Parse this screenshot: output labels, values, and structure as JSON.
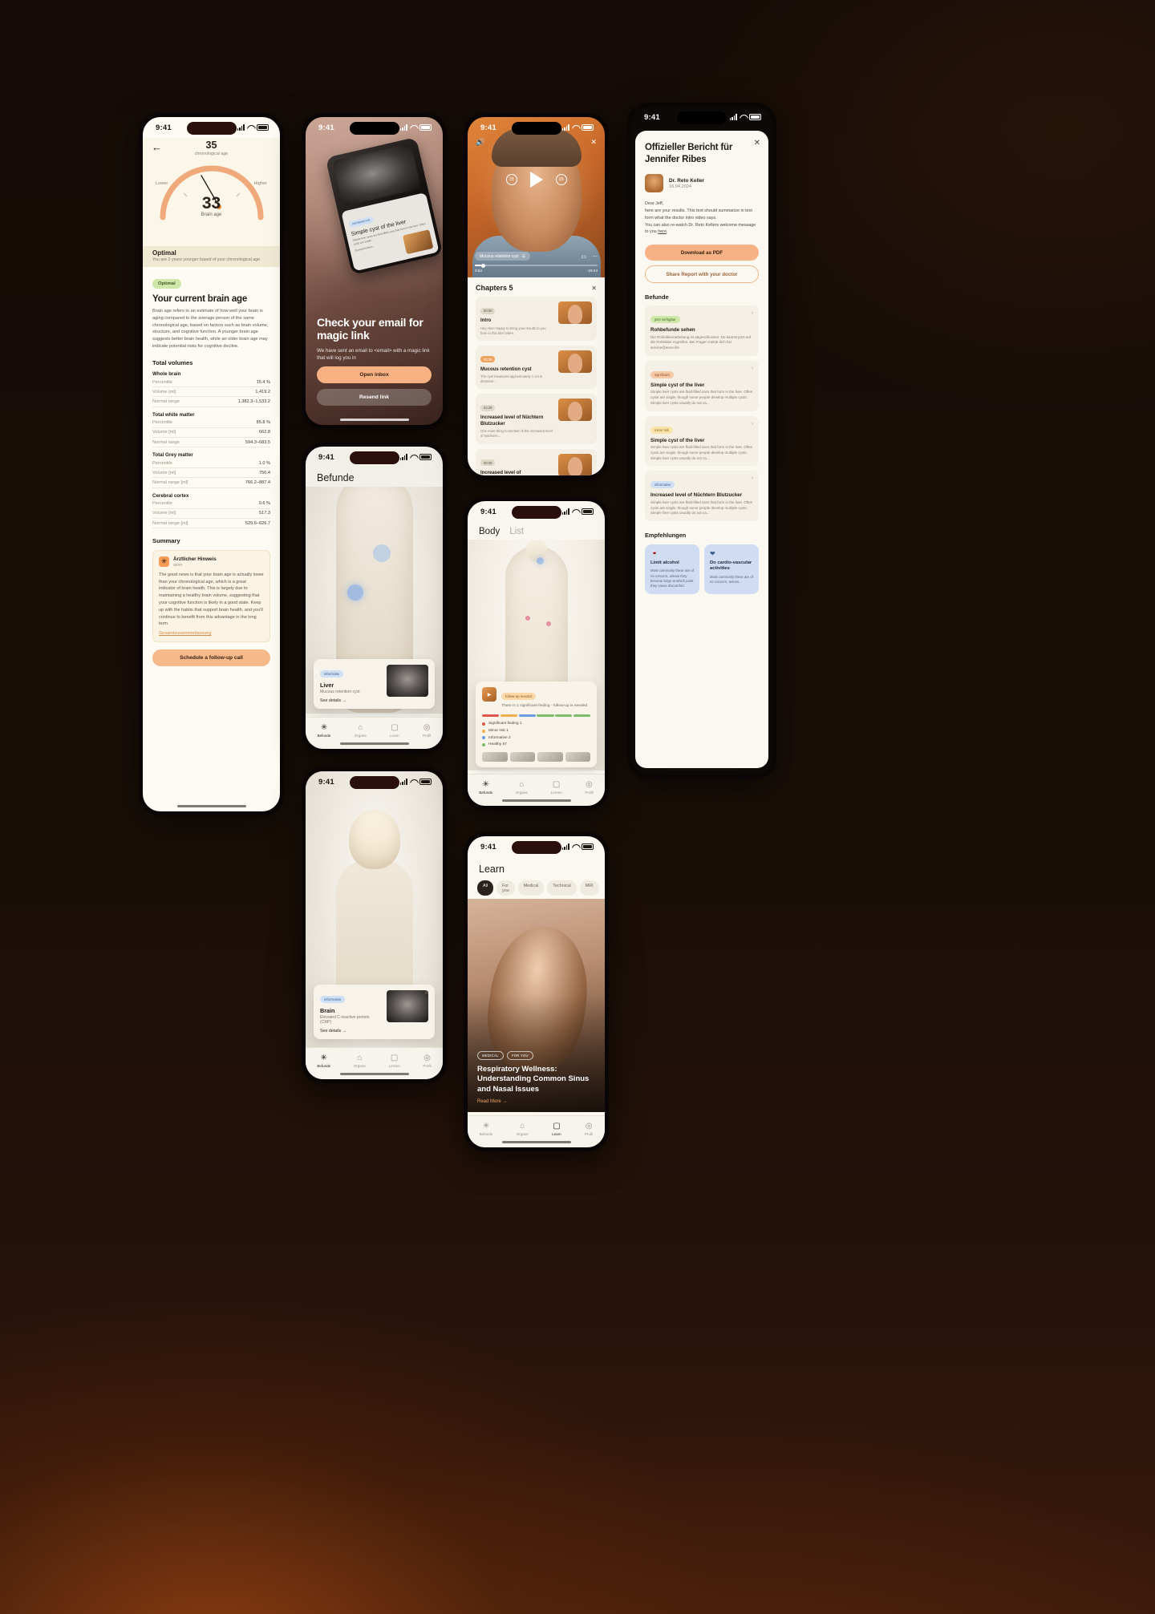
{
  "common": {
    "status_time": "9:41"
  },
  "brain_age": {
    "back_icon": "←",
    "chrono_value": "35",
    "chrono_label": "chronological age",
    "gauge_low": "Lower",
    "gauge_high": "Higher",
    "brain_age_value": "33",
    "brain_age_label": "Brain age",
    "banner_title": "Optimal",
    "banner_sub": "You are 2 years younger based of your chronological age",
    "badge": "Optimal",
    "title": "Your current brain age",
    "body": "Brain age refers to an estimate of how well your brain is aging compared to the average person of the same chronological age, based on factors such as brain volume, structure, and cognitive function. A younger brain age suggests better brain health, while an older brain age may indicate potential risks for cognitive decline.",
    "volumes_title": "Total volumes",
    "groups": [
      {
        "name": "Whole brain",
        "rows": [
          {
            "k": "Percentile",
            "v": "15.4 %"
          },
          {
            "k": "Volume [ml]",
            "v": "1,419.2"
          },
          {
            "k": "Normal range",
            "v": "1,382.3–1,533.2"
          }
        ]
      },
      {
        "name": "Total white matter",
        "rows": [
          {
            "k": "Percentile",
            "v": "85.8 %"
          },
          {
            "k": "Volume [ml]",
            "v": "662.8"
          },
          {
            "k": "Normal range",
            "v": "594.3–683.5"
          }
        ]
      },
      {
        "name": "Total Grey matter",
        "rows": [
          {
            "k": "Percentile",
            "v": "1.0 %"
          },
          {
            "k": "Volume [ml]",
            "v": "756.4"
          },
          {
            "k": "Normal range [ml]",
            "v": "766.2–887.4"
          }
        ]
      },
      {
        "name": "Cerebral cortex",
        "rows": [
          {
            "k": "Percentile",
            "v": "0.6 %"
          },
          {
            "k": "Volume [ml]",
            "v": "517.3"
          },
          {
            "k": "Normal range [ml]",
            "v": "529.6–626.7"
          }
        ]
      }
    ],
    "summary_title": "Summary",
    "note_icon": "✳",
    "note_name": "Ärztlicher Hinweis",
    "note_sub": "aeon",
    "note_body": "The good news is that your brain age is actually lower than your chronological age, which is a great indicator of brain health. This is largely due to maintaining a healthy brain volume, suggesting that your cognitive function is likely in a good state. Keep up with the habits that support brain health, and you'll continue to benefit from this advantage in the long term.",
    "note_link": "Gesamtzusammenfassung",
    "cta": "Schedule a follow-up call"
  },
  "magic_link": {
    "card_tag": "INFORMATIVE",
    "card_title": "Simple cyst of the liver",
    "card_text": "Simple liver cysts are fluid-filled sacs that form in the liver. Often cysts are single...",
    "card_link": "Zusammenfass...",
    "title": "Check your email for magic link",
    "body": "We have sent an email to <email> with a magic link that will log you in",
    "primary_btn": "Open inbox",
    "secondary_btn": "Resend link"
  },
  "befunde": {
    "title": "Befunde",
    "finding_tag": "informativ",
    "finding_title": "Liver",
    "finding_sub": "Mucous retention cyst",
    "finding_link": "See details  →",
    "tabs": [
      {
        "icon": "✳",
        "label": "Befunde",
        "active": true
      },
      {
        "icon": "⌂",
        "label": "Organe",
        "active": false
      },
      {
        "icon": "▢",
        "label": "Learn",
        "active": false
      },
      {
        "icon": "◎",
        "label": "Profil",
        "active": false
      }
    ]
  },
  "head_view": {
    "finding_tag": "informative",
    "finding_title": "Brain",
    "finding_sub": "Elevated C-reactive protein (CRP)",
    "finding_link": "See details  →",
    "close_icon": "✕",
    "tabs": [
      {
        "icon": "✳",
        "label": "Befunde",
        "active": true
      },
      {
        "icon": "⌂",
        "label": "Organe",
        "active": false
      },
      {
        "icon": "▢",
        "label": "Lernen",
        "active": false
      },
      {
        "icon": "◎",
        "label": "Profil",
        "active": false
      }
    ]
  },
  "video": {
    "mute_icon": "🔊",
    "close_icon": "✕",
    "skip_back": "15",
    "skip_fwd": "15",
    "chip_label": "Mucous retention cyst",
    "chip_icon": "☰",
    "airplay_icon": "▭",
    "more_icon": "⋯",
    "time_current": "0:54",
    "time_total": "-19:44",
    "chapters_title": "Chapters",
    "chapters_count": "5",
    "chapters_close": "✕",
    "chapters": [
      {
        "time": "00:00",
        "active": false,
        "title": "Intro",
        "text": "Hey Alex! Happy to bring your results to you here in this brief video."
      },
      {
        "time": "00:39",
        "active": true,
        "title": "Mucous retention cyst",
        "text": "The cyst measures approximately 1 cm in diameter..."
      },
      {
        "time": "02:29",
        "active": false,
        "title": "Increased level of Nüchtern Blutzucker",
        "text": "One more thing to mention is the increased level of Nüchtern..."
      },
      {
        "time": "00:29",
        "active": false,
        "title": "Increased level of",
        "text": ""
      }
    ]
  },
  "body_list": {
    "tabs": [
      {
        "label": "Body",
        "active": true
      },
      {
        "label": "List",
        "active": false
      }
    ],
    "card_tag": "follow-up needed",
    "card_text": "There is 1 significant finding - follow-up is needed.",
    "card_icon": "▶",
    "legend": [
      {
        "label": "Significant finding 1",
        "color": "#e0574f"
      },
      {
        "label": "Minor risk 1",
        "color": "#efb04a"
      },
      {
        "label": "Informative 2",
        "color": "#6b9ae0"
      },
      {
        "label": "Healthy 57",
        "color": "#7dbb6a"
      }
    ],
    "bar_colors": [
      "#e0574f",
      "#efb04a",
      "#6b9ae0",
      "#7dbb6a",
      "#7dbb6a",
      "#7dbb6a"
    ],
    "tabs_bottom": [
      {
        "icon": "✳",
        "label": "Befunde",
        "active": true
      },
      {
        "icon": "⌂",
        "label": "Organe",
        "active": false
      },
      {
        "icon": "▢",
        "label": "Lernen",
        "active": false
      },
      {
        "icon": "◎",
        "label": "Profil",
        "active": false
      }
    ]
  },
  "learn": {
    "title": "Learn",
    "chips": [
      {
        "label": "All",
        "active": true
      },
      {
        "label": "For you",
        "active": false
      },
      {
        "label": "Medical",
        "active": false
      },
      {
        "label": "Technical",
        "active": false
      },
      {
        "label": "MRI",
        "active": false
      }
    ],
    "hero_tags": [
      "MEDICAL",
      "FOR YOU"
    ],
    "hero_title": "Respiratory Wellness: Understanding Common Sinus and Nasal Issues",
    "hero_more": "Read More  →",
    "tabs": [
      {
        "icon": "✳",
        "label": "Befunde",
        "active": false
      },
      {
        "icon": "⌂",
        "label": "Organe",
        "active": false
      },
      {
        "icon": "▢",
        "label": "Learn",
        "active": true
      },
      {
        "icon": "◎",
        "label": "Profil",
        "active": false
      }
    ]
  },
  "report": {
    "close_icon": "✕",
    "title": "Offizieller Bericht für Jennifer Ribes",
    "doctor_name": "Dr. Reto Keller",
    "doctor_date": "16.04.2024",
    "intro_line1": "Dear Jeff,",
    "intro_line2": "here are your results. This text should summarize in text form what the doctor intro video says.",
    "intro_line3": "You can also re-watch Dr. Reto Kellers welcome message to you ",
    "intro_link": "here",
    "intro_end": ".",
    "btn_pdf": "Download as PDF",
    "btn_share": "Share Report with your doctor",
    "findings_title": "Befunde",
    "findings": [
      {
        "tag": "jetzt verfügbar",
        "tag_bg": "#cfe8a9",
        "tag_fg": "#42611f",
        "title": "Rohbefunde sehen",
        "text": "Die Rohbildverarbeitung ist abgeschlossen. Du kannst jetzt auf die Rohbilder zugreifen. Bei Fragen melde dich bei service@aeon.life"
      },
      {
        "tag": "significant",
        "tag_bg": "#f6c9a6",
        "tag_fg": "#8a4a1d",
        "title": "Simple cyst of the liver",
        "text": "Simple liver cysts are fluid-filled sacs that form in the liver. Often cysts are single, though some people develop multiple cysts. Simple liver cysts usually do not ca..."
      },
      {
        "tag": "minor risk",
        "tag_bg": "#fae3a8",
        "tag_fg": "#8a6a1d",
        "title": "Simple cyst of the liver",
        "text": "Simple liver cysts are fluid-filled sacs that form in the liver. Often cysts are single, though some people develop multiple cysts. Simple liver cysts usually do not ca..."
      },
      {
        "tag": "informative",
        "tag_bg": "#cfe0f5",
        "tag_fg": "#42608c",
        "title": "Increased level of Nüchtern Blutzucker",
        "text": "Simple liver cysts are fluid-filled sacs that form in the liver. Often cysts are single, though some people develop multiple cysts. Simple liver cysts usually do not ca..."
      }
    ],
    "rec_title": "Empfehlungen",
    "recommendations": [
      {
        "icon": "🍷",
        "title": "Limit alcohol",
        "text": "Most commonly these are of no concern, unless they become large at which point they cause discomfort."
      },
      {
        "icon": "❤",
        "title": "Do cardio-vascular activities",
        "text": "Most commonly these are of no concern, unless..."
      }
    ]
  }
}
